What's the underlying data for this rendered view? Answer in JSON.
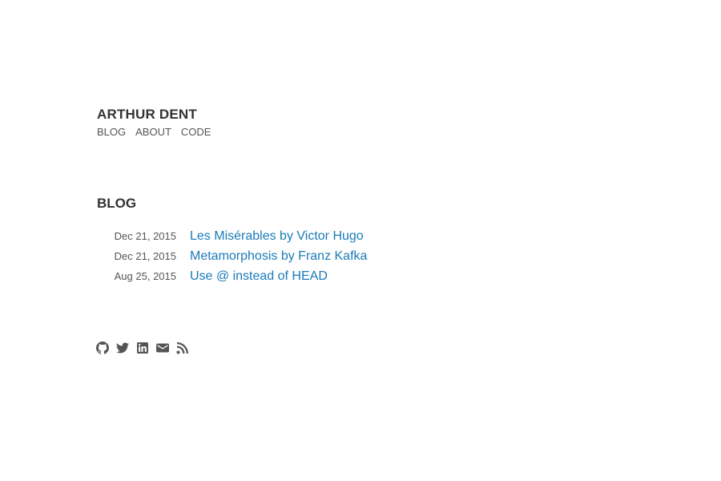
{
  "header": {
    "site_title": "ARTHUR DENT",
    "nav": [
      {
        "label": "BLOG"
      },
      {
        "label": "ABOUT"
      },
      {
        "label": "CODE"
      }
    ]
  },
  "blog": {
    "heading": "BLOG",
    "posts": [
      {
        "date": "Dec 21, 2015",
        "title": "Les Misérables by Victor Hugo"
      },
      {
        "date": "Dec 21, 2015",
        "title": "Metamorphosis by Franz Kafka"
      },
      {
        "date": "Aug 25, 2015",
        "title": "Use @ instead of HEAD"
      }
    ]
  },
  "social": {
    "icons": [
      "github-icon",
      "twitter-icon",
      "linkedin-icon",
      "mail-icon",
      "rss-icon"
    ]
  },
  "colors": {
    "link": "#1a7bb8",
    "text": "#333333",
    "muted": "#555555"
  }
}
